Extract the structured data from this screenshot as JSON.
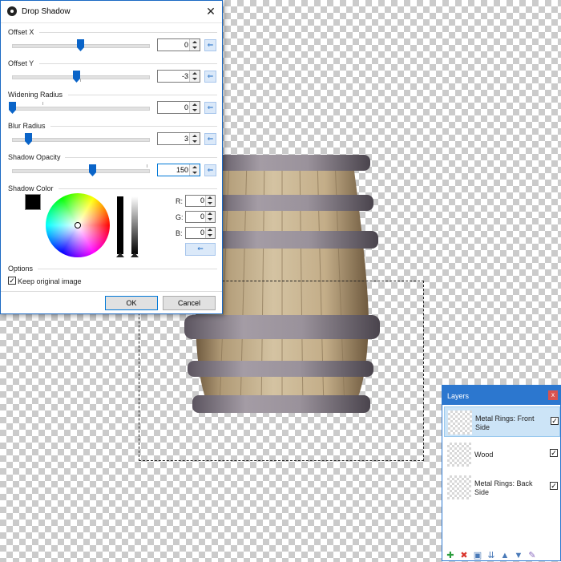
{
  "dialog": {
    "title": "Drop Shadow",
    "offset_x": {
      "label": "Offset X",
      "value": "0",
      "level": 0.5
    },
    "offset_y": {
      "label": "Offset Y",
      "value": "-3",
      "level": 0.47
    },
    "widening_radius": {
      "label": "Widening Radius",
      "value": "0",
      "level": 0.0
    },
    "blur_radius": {
      "label": "Blur Radius",
      "value": "3",
      "level": 0.12
    },
    "shadow_opacity": {
      "label": "Shadow Opacity",
      "value": "150",
      "level": 0.59
    },
    "shadow_color": {
      "label": "Shadow Color",
      "swatch": "#000000",
      "r_label": "R:",
      "r": "0",
      "g_label": "G:",
      "g": "0",
      "b_label": "B:",
      "b": "0"
    },
    "options": {
      "label": "Options",
      "keep_original_label": "Keep original image",
      "keep_original_checked": true
    },
    "ok_label": "OK",
    "cancel_label": "Cancel",
    "accent": "#1b69c4"
  },
  "layers": {
    "title": "Layers",
    "close": "x",
    "items": [
      {
        "name": "Metal Rings: Front Side",
        "visible": true,
        "selected": true
      },
      {
        "name": "Wood",
        "visible": true,
        "selected": false
      },
      {
        "name": "Metal Rings: Back Side",
        "visible": true,
        "selected": false
      }
    ],
    "toolbar_icons": [
      "add-layer-icon",
      "delete-layer-icon",
      "duplicate-layer-icon",
      "merge-layer-down-icon",
      "move-layer-up-icon",
      "move-layer-down-icon",
      "layer-properties-icon"
    ]
  }
}
